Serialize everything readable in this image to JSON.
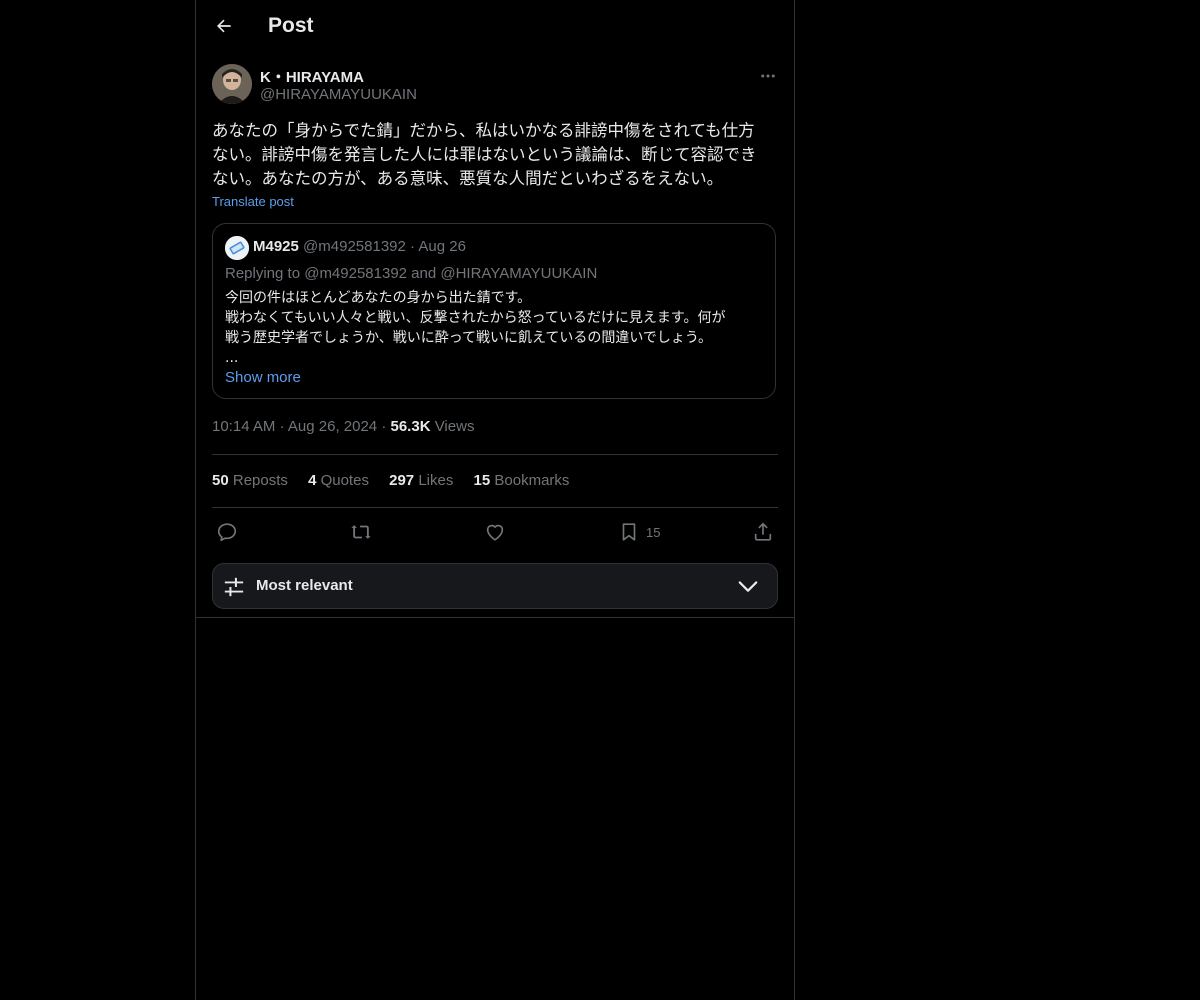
{
  "header": {
    "title": "Post",
    "back_icon": "arrow-left-icon"
  },
  "author": {
    "name": "K・HIRAYAMA",
    "handle": "@HIRAYAMAYUUKAIN",
    "more_icon": "more-horizontal-icon"
  },
  "post": {
    "lines": [
      "あなたの「身からでた錆」だから、私はいかなる誹謗中傷をされても仕方",
      "ない。誹謗中傷を発言した人には罪はないという議論は、断じて容認でき",
      "ない。あなたの方が、ある意味、悪質な人間だといわざるをえない。"
    ],
    "translate_label": "Translate post"
  },
  "quote": {
    "name": "M4925",
    "handle": "@m492581392",
    "separator": "·",
    "date": "Aug 26",
    "replying_to": "Replying to @m492581392 and @HIRAYAMAYUUKAIN",
    "lines": [
      "今回の件はほとんどあなたの身から出た錆です。",
      "戦わなくてもいい人々と戦い、反撃されたから怒っているだけに見えます。何が",
      "戦う歴史学者でしょうか、戦いに酔って戦いに飢えているの間違いでしょう。",
      "..."
    ],
    "show_more_label": "Show more"
  },
  "meta": {
    "time": "10:14 AM",
    "separator": "·",
    "date": "Aug 26, 2024",
    "views_count": "56.3K",
    "views_label": "Views"
  },
  "stats": [
    {
      "count": "50",
      "label": "Reposts"
    },
    {
      "count": "4",
      "label": "Quotes"
    },
    {
      "count": "297",
      "label": "Likes"
    },
    {
      "count": "15",
      "label": "Bookmarks"
    }
  ],
  "actions": {
    "reply_icon": "reply-icon",
    "repost_icon": "repost-icon",
    "like_icon": "heart-icon",
    "bookmark_icon": "bookmark-icon",
    "bookmark_count": "15",
    "share_icon": "share-icon"
  },
  "sort": {
    "label": "Most relevant",
    "icon": "sliders-icon",
    "chevron": "chevron-down-icon"
  },
  "colors": {
    "background": "#000000",
    "text_primary": "#e7e9ea",
    "text_secondary": "#71767b",
    "link": "#5c9ded",
    "border": "#2f3336"
  }
}
